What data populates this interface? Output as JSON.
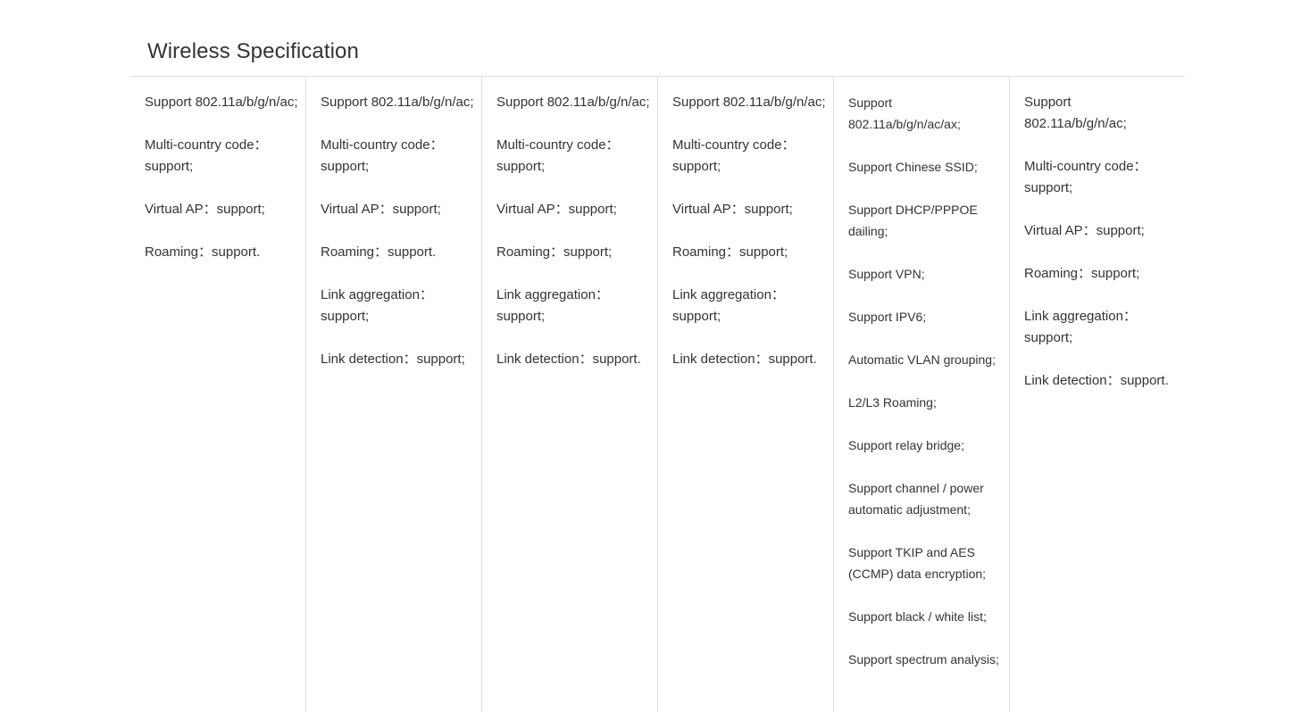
{
  "section": {
    "title": "Wireless Specification"
  },
  "columns": [
    {
      "items": [
        "Support 802.11a/b/g/n/ac;",
        "Multi-country code：support;",
        "Virtual AP：support;",
        "Roaming：support."
      ]
    },
    {
      "items": [
        "Support 802.11a/b/g/n/ac;",
        "Multi-country code：support;",
        "Virtual AP：support;",
        "Roaming：support.",
        "Link aggregation：support;",
        "Link detection：support;"
      ]
    },
    {
      "items": [
        "Support 802.11a/b/g/n/ac;",
        "Multi-country code：support;",
        "Virtual AP：support;",
        "Roaming：support;",
        "Link aggregation：support;",
        "Link detection：support."
      ]
    },
    {
      "items": [
        "Support 802.11a/b/g/n/ac;",
        "Multi-country code：support;",
        "Virtual AP：support;",
        "Roaming：support;",
        "Link aggregation：support;",
        "Link detection：support."
      ]
    },
    {
      "items": [
        "Support 802.11a/b/g/n/ac/ax;",
        "Support Chinese SSID;",
        "Support DHCP/PPPOE dailing;",
        "Support VPN;",
        "Support IPV6;",
        "Automatic VLAN grouping;",
        "L2/L3 Roaming;",
        "Support relay bridge;",
        "Support channel / power automatic adjustment;",
        "Support TKIP and AES (CCMP) data encryption;",
        "Support black / white list;",
        "Support spectrum analysis;"
      ]
    },
    {
      "items": [
        "Support 802.11a/b/g/n/ac;",
        "Multi-country code：support;",
        "Virtual AP：support;",
        "Roaming：support;",
        "Link aggregation：support;",
        "Link detection：support."
      ]
    }
  ]
}
